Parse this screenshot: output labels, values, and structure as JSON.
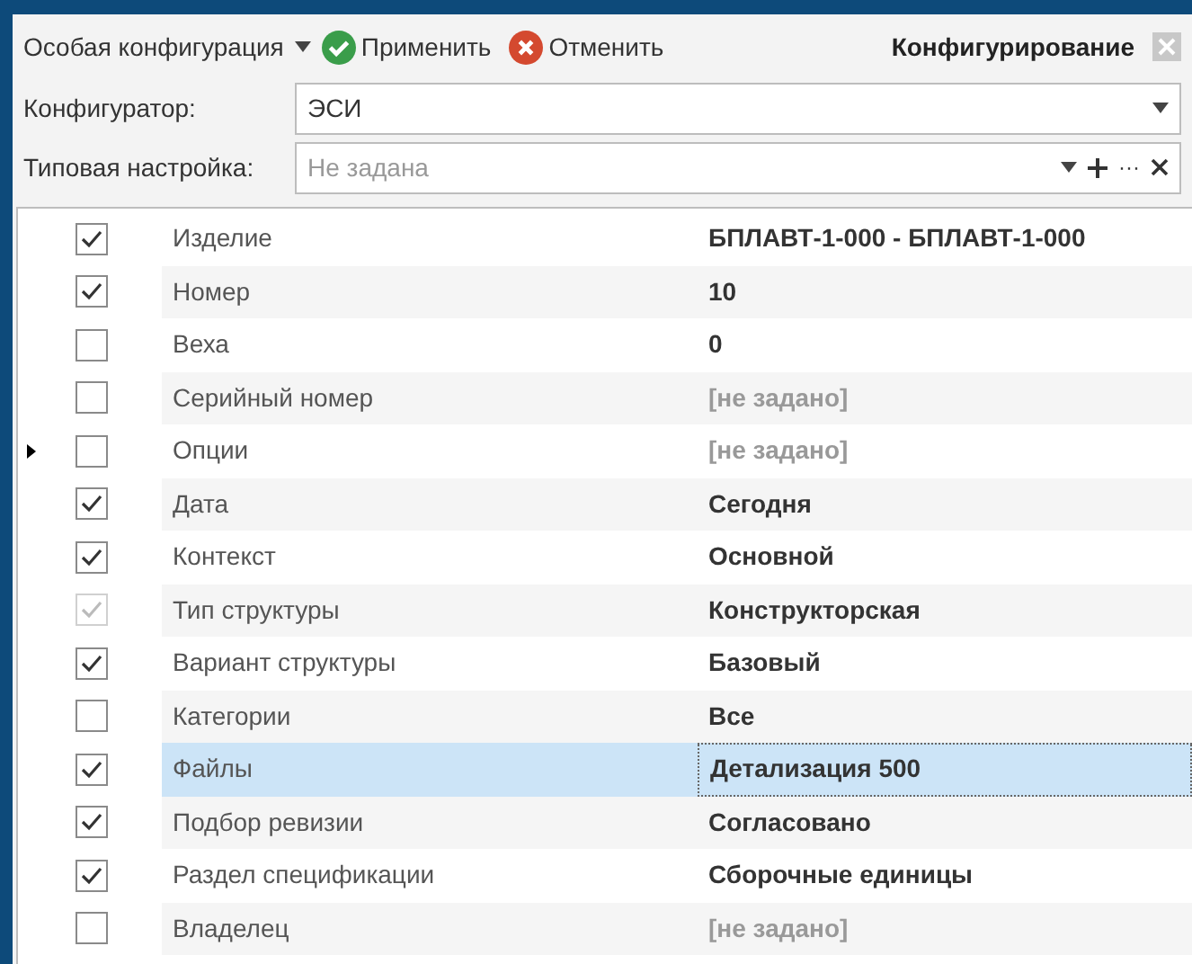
{
  "toolbar": {
    "mode": "Особая конфигурация",
    "apply": "Применить",
    "cancel": "Отменить",
    "title": "Конфигурирование"
  },
  "configurator": {
    "label": "Конфигуратор:",
    "value": "ЭСИ"
  },
  "preset": {
    "label": "Типовая настройка:",
    "placeholder": "Не задана",
    "dots": "···"
  },
  "rows": [
    {
      "name": "Изделие",
      "value": "БПЛАВТ-1-000  - БПЛАВТ-1-000",
      "checked": true,
      "disabled": false,
      "unset": false,
      "current": false,
      "selected": false
    },
    {
      "name": "Номер",
      "value": "10",
      "checked": true,
      "disabled": false,
      "unset": false,
      "current": false,
      "selected": false
    },
    {
      "name": "Веха",
      "value": "0",
      "checked": false,
      "disabled": false,
      "unset": false,
      "current": false,
      "selected": false
    },
    {
      "name": "Серийный номер",
      "value": "[не задано]",
      "checked": false,
      "disabled": false,
      "unset": true,
      "current": false,
      "selected": false
    },
    {
      "name": "Опции",
      "value": "[не задано]",
      "checked": false,
      "disabled": false,
      "unset": true,
      "current": true,
      "selected": false
    },
    {
      "name": "Дата",
      "value": "Сегодня",
      "checked": true,
      "disabled": false,
      "unset": false,
      "current": false,
      "selected": false
    },
    {
      "name": "Контекст",
      "value": "Основной",
      "checked": true,
      "disabled": false,
      "unset": false,
      "current": false,
      "selected": false
    },
    {
      "name": "Тип структуры",
      "value": "Конструкторская",
      "checked": true,
      "disabled": true,
      "unset": false,
      "current": false,
      "selected": false
    },
    {
      "name": "Вариант структуры",
      "value": "Базовый",
      "checked": true,
      "disabled": false,
      "unset": false,
      "current": false,
      "selected": false
    },
    {
      "name": "Категории",
      "value": "Все",
      "checked": false,
      "disabled": false,
      "unset": false,
      "current": false,
      "selected": false
    },
    {
      "name": "Файлы",
      "value": "Детализация 500",
      "checked": true,
      "disabled": false,
      "unset": false,
      "current": false,
      "selected": true
    },
    {
      "name": "Подбор ревизии",
      "value": "Согласовано",
      "checked": true,
      "disabled": false,
      "unset": false,
      "current": false,
      "selected": false
    },
    {
      "name": "Раздел спецификации",
      "value": "Сборочные единицы",
      "checked": true,
      "disabled": false,
      "unset": false,
      "current": false,
      "selected": false
    },
    {
      "name": "Владелец",
      "value": "[не задано]",
      "checked": false,
      "disabled": false,
      "unset": true,
      "current": false,
      "selected": false
    }
  ]
}
